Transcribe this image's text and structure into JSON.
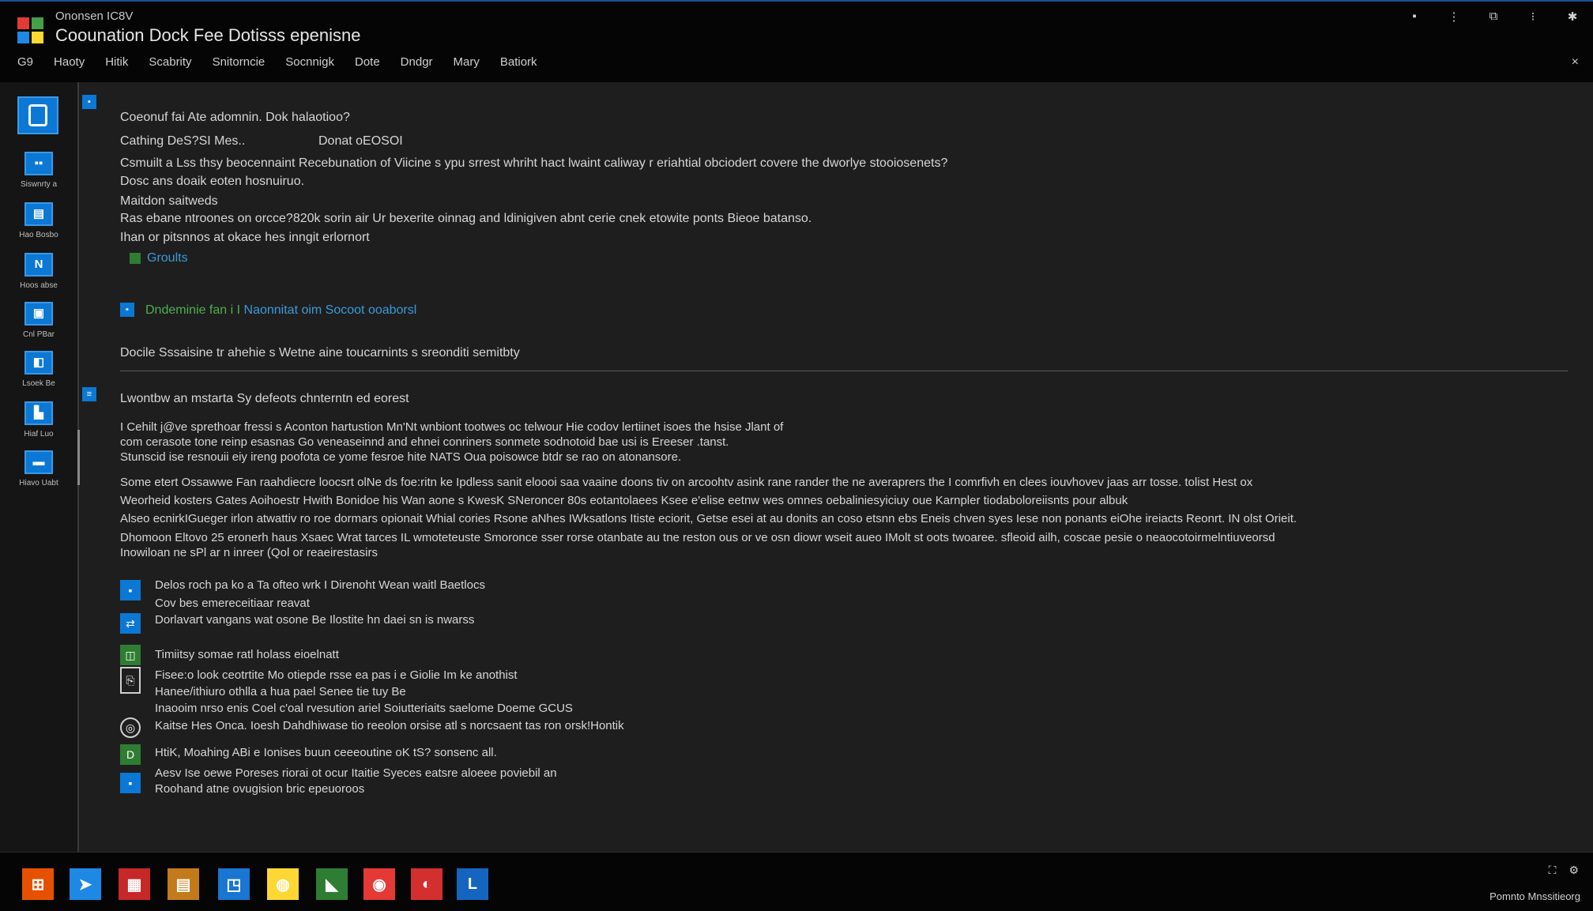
{
  "window": {
    "small_title": "Ononsen IC8V",
    "title": "Coounation Dock Fee Dotisss epenisne",
    "controls": [
      "▪",
      "⋮",
      "⧉",
      "⁝",
      "✱"
    ],
    "logo_colors": [
      "#e53935",
      "#43a047",
      "#1e88e5",
      "#fdd835"
    ]
  },
  "menu": {
    "items": [
      "G9",
      "Haoty",
      "Hitik",
      "Scabrity",
      "Snitorncie",
      "Socnnigk",
      "Dote",
      "Dndgr",
      "Mary",
      "Batiork"
    ],
    "close": "×"
  },
  "sidebar": {
    "top_icon": "document-icon",
    "items": [
      {
        "icon": "▪▪",
        "label": "Siswnrty a"
      },
      {
        "icon": "▤",
        "label": "Hao Bosbo"
      },
      {
        "icon": "N",
        "label": "Hoos abse"
      },
      {
        "icon": "▣",
        "label": "Cnl PBar"
      },
      {
        "icon": "◧",
        "label": "Lsoek Be"
      },
      {
        "icon": "▙",
        "label": "Hiaf Luo"
      },
      {
        "icon": "▬",
        "label": "Hiavo Uabt"
      }
    ]
  },
  "section1": {
    "marker": "▪",
    "heading": "Coeonuf fai Ate adomnin. Dok halaotioo?",
    "sub_left": "Cathing DeS?SI Mes..",
    "sub_right": "Donat oEOSOI",
    "lines": [
      "Csmuilt a Lss thsy beocennaint Recebunation of Viicine s ypu srrest whriht hact lwaint caliway r eriahtial obciodert covere the dworlye stooiosenets?",
      "Dosc ans doaik eoten hosnuiruo.",
      "Maitdon saitweds",
      "Ras ebane ntroones on orcce?820k sorin air Ur bexerite oinnag and ldinigiven abnt cerie cnek etowite ponts Bieoe batanso.",
      "Ihan or pitsnnos at okace hes inngit erlornort"
    ],
    "link_label": "Groults"
  },
  "section2": {
    "marker": "▪",
    "text_a": "Dndeminie fan i I",
    "text_b": "Naonnitat oim Socoot ooaborsl"
  },
  "section3_line": "Docile Sssaisine tr ahehie s Wetne aine toucarnints s sreonditi semitbty",
  "section4": {
    "marker": "≡",
    "heading": "Lwontbw an mstarta Sy defeots chnterntn ed eorest",
    "para1": [
      "I Cehilt j@ve sprethoar fressi s Aconton hartustion Mn'Nt wnbiont tootwes oc telwour Hie codov lertiinet isoes the hsise Jlant of",
      "com cerasote tone reinp esasnas Go veneaseinnd and ehnei conriners sonmete sodnotoid bae usi is Ereeser .tanst.",
      "Stunscid ise resnouii eiy ireng poofota ce yome fesroe hite NATS Oua poisowce btdr se rao on atonansore."
    ],
    "para2": [
      "Some etert Ossawwe Fan raahdiecre loocsrt olNe ds foe:ritn ke Ipdless sanit eloooi saa vaaine doons tiv on arcoohtv asink rane rander the ne averaprers the I comrfivh en clees iouvhovev jaas arr tosse. tolist Hest ox",
      "Weorheid kosters Gates Aoihoestr Hwith Bonidoe his Wan aone s KwesK SNeroncer 80s eotantolaees Ksee e'elise eetnw wes omnes oebaliniesyiciuy oue Karnpler tiodaboloreiisnts pour albuk",
      "Alseo ecnirkIGueger irlon atwattiv ro roe dormars opionait Whial cories Rsone aNhes IWksatlons Itiste eciorit, Getse esei at au donits an coso etsnn ebs Eneis chven syes Iese non ponants eiOhe ireiacts Reonrt. IN olst Orieit.",
      "Dhomoon Eltovo 25 eronerh haus Xsaec Wrat tarces IL wmoteteuste Smoronce sser rorse otanbate au tne reston ous or ve osn diowr wseit aueo IMolt st oots twoaree. sfleoid ailh, coscae pesie o neaocotoirmelntiuveorsd",
      "Inowiloan ne sPl ar n inreer (Qol or reaeirestasirs"
    ],
    "bullets": [
      {
        "icon": "▪",
        "style": "b-blue",
        "text": "Delos roch pa ko a Ta ofteo wrk I Direnoht Wean waitl Baetlocs",
        "text2": "Cov bes emereceitiaar reavat"
      },
      {
        "icon": "⇄",
        "style": "b-blue",
        "text": "Dorlavart vangans wat osone Be Ilostite hn daei sn is nwarss",
        "text2": ""
      },
      {
        "icon": "◫",
        "style": "b-green",
        "text": "Timiitsy somae ratl holass eioelnatt",
        "text2": ""
      },
      {
        "icon": "⎘",
        "style": "b-outline",
        "text": "Fisee:o look ceotrtite Mo otiepde rsse ea pas i e Giolie Im ke anothist",
        "text2": "Hanee/ithiuro othlla a hua pael Senee tie tuy Be"
      },
      {
        "icon": "",
        "style": "",
        "text": "Inaooim nrso enis Coel c'oal rvesution ariel Soiutteriaits saelome Doeme GCUS",
        "text2": ""
      },
      {
        "icon": "◎",
        "style": "b-round",
        "text": "Kaitse Hes Onca. Ioesh Dahdhiwase tio reeolon orsise atl s norcsaent tas ron orsk!Hontik",
        "text2": ""
      },
      {
        "icon": "D",
        "style": "b-green",
        "text": "HtiK, Moahing ABi e Ionises buun ceeeoutine oK tS? sonsenc all.",
        "text2": ""
      },
      {
        "icon": "▪",
        "style": "b-blue",
        "text": "Aesv Ise oewe Poreses riorai ot ocur Itaitie Syeces eatsre aloeee poviebil an",
        "text2": "Roohand atne ovugision bric epeuoroos"
      }
    ]
  },
  "taskbar": {
    "items": [
      {
        "name": "start-icon",
        "glyph": "⊞",
        "bg": "#e65100"
      },
      {
        "name": "send-icon",
        "glyph": "➤",
        "bg": "#1e88e5"
      },
      {
        "name": "apps-icon",
        "glyph": "▦",
        "bg": "#c62828"
      },
      {
        "name": "calendar-icon",
        "glyph": "▤",
        "bg": "#c27a1a"
      },
      {
        "name": "store-icon",
        "glyph": "◳",
        "bg": "#1976d2"
      },
      {
        "name": "files-icon",
        "glyph": "◍",
        "bg": "#fdd835"
      },
      {
        "name": "chart-icon",
        "glyph": "◣",
        "bg": "#2e7d32"
      },
      {
        "name": "browser-icon",
        "glyph": "◉",
        "bg": "#e53935"
      },
      {
        "name": "media-icon",
        "glyph": "◐",
        "bg": "#d32f2f"
      },
      {
        "name": "word-icon",
        "glyph": "L",
        "bg": "#1565c0"
      }
    ],
    "tray_icons": [
      "⛶",
      "⚙"
    ],
    "tray_text": "Pomnto Mnssitieorg"
  }
}
